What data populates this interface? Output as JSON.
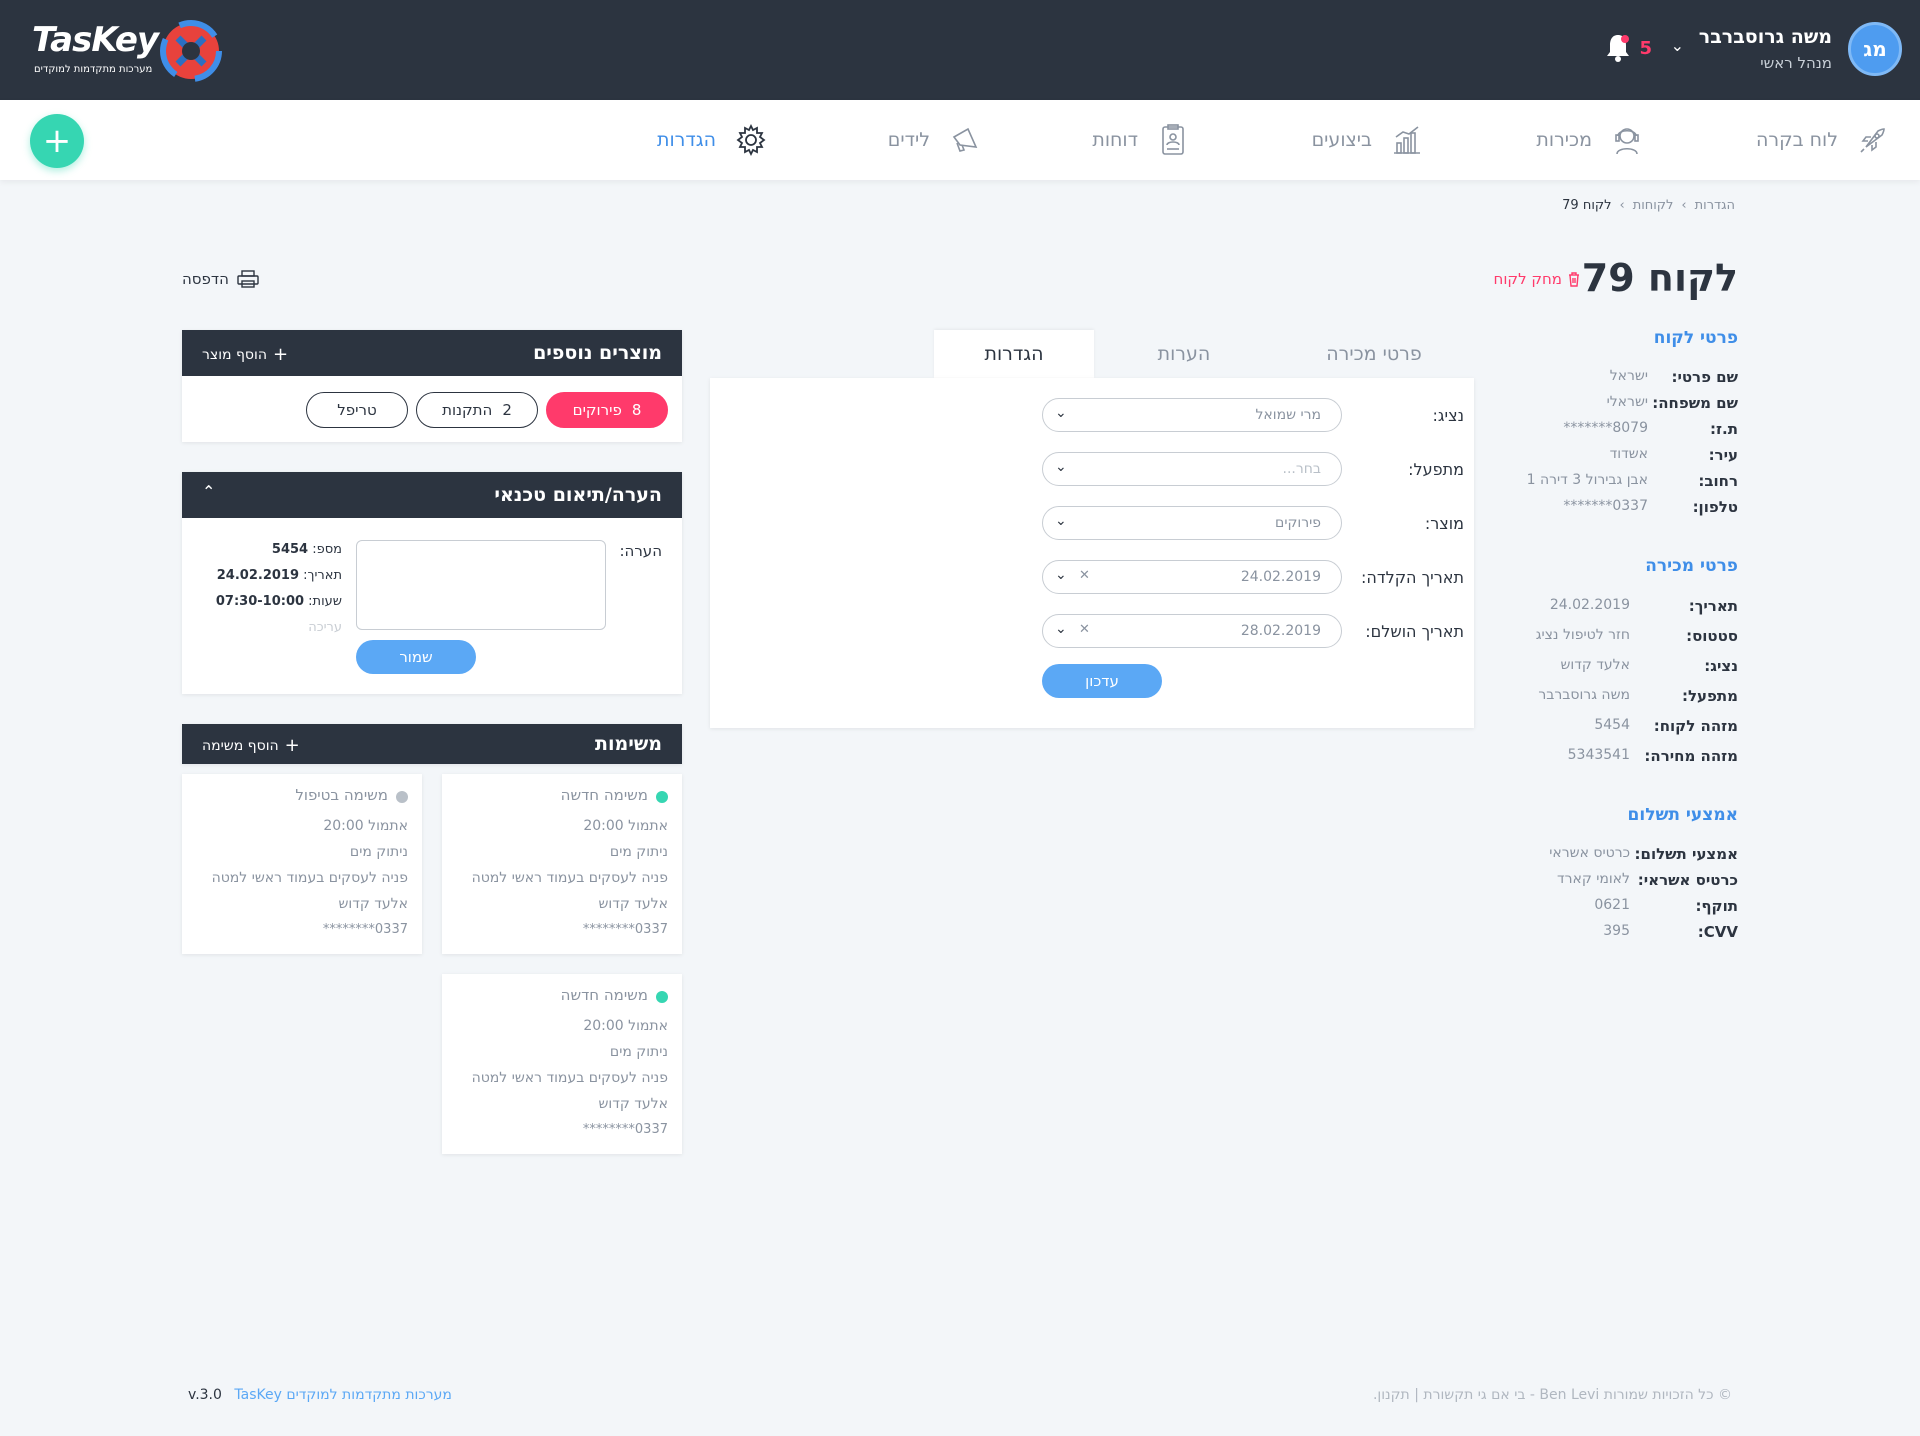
{
  "brand": {
    "name": "TasKey",
    "tagline": "מערכות מתקדמות למוקדים"
  },
  "user": {
    "initials": "מג",
    "name": "משה גרוסברבר",
    "role": "מנהל ראשי",
    "notifications": "5"
  },
  "nav": {
    "items": [
      {
        "label": "לוח בקרה",
        "icon": "rocket-icon"
      },
      {
        "label": "מכירות",
        "icon": "agent-icon"
      },
      {
        "label": "ביצועים",
        "icon": "chart-icon"
      },
      {
        "label": "דוחות",
        "icon": "report-icon"
      },
      {
        "label": "לידים",
        "icon": "megaphone-icon"
      },
      {
        "label": "הגדרות",
        "icon": "gear-icon"
      }
    ],
    "active_color": "#3f8ee8"
  },
  "breadcrumb": {
    "a": "הגדרות",
    "b": "לקוחות",
    "c": "לקוח 79"
  },
  "page": {
    "title": "לקוח 79",
    "delete_label": "מחק לקוח",
    "print_label": "הדפסה"
  },
  "customer": {
    "title": "פרטי לקוח",
    "rows": [
      {
        "label": "שם פרטי:",
        "value": "ישראל"
      },
      {
        "label": "שם משפחה:",
        "value": "ישראלי"
      },
      {
        "label": "ת.ז:",
        "value": "8079*******"
      },
      {
        "label": "עיר:",
        "value": "אשדוד"
      },
      {
        "label": "רחוב:",
        "value": "אבן גבירול 3 דירה 1"
      },
      {
        "label": "טלפון:",
        "value": "0337*******"
      }
    ]
  },
  "sale": {
    "title": "פרטי מכירה",
    "rows": [
      {
        "label": "תאריך:",
        "value": "24.02.2019"
      },
      {
        "label": "סטטוס:",
        "value": "חזר לטיפול נציג"
      },
      {
        "label": "נציג:",
        "value": "אלעד קדוש"
      },
      {
        "label": "מתפעל:",
        "value": "משה גרוסברבר"
      },
      {
        "label": "מזהה לקוח:",
        "value": "5454"
      },
      {
        "label": "מזהה מחירה:",
        "value": "5343541"
      }
    ]
  },
  "payment": {
    "title": "אמצעי תשלום",
    "rows": [
      {
        "label": "אמצעי תשלום:",
        "value": "כרטיס אשראי"
      },
      {
        "label": "כרטיס אשראי:",
        "value": "לאומי קארד"
      },
      {
        "label": "תוקף:",
        "value": "0621"
      },
      {
        "label": "CVV:",
        "value": "395"
      }
    ]
  },
  "tabs": {
    "sale": "פרטי מכירה",
    "notes": "הערות",
    "settings": "הגדרות"
  },
  "form": {
    "rep_label": "נציג:",
    "rep_value": "מרי שמואל",
    "operator_label": "מתפעל:",
    "operator_placeholder": "בחר...",
    "product_label": "מוצר:",
    "product_value": "פירוקים",
    "entry_label": "תאריך הקלדה:",
    "entry_value": "24.02.2019",
    "done_label": "תאריך הושלם:",
    "done_value": "28.02.2019",
    "update_button": "עדכון"
  },
  "products": {
    "title": "מוצרים נוספים",
    "add_label": "הוסף מוצר",
    "chips": [
      {
        "count": "8",
        "label": "פירוקים"
      },
      {
        "count": "2",
        "label": "התקנות"
      },
      {
        "count": "",
        "label": "טריפל"
      }
    ]
  },
  "notes": {
    "title": "הערה/תיאום טכנאי",
    "note_label": "הערה:",
    "number_label": "מספ:",
    "number_value": "5454",
    "date_label": "תאריך:",
    "date_value": "24.02.2019",
    "hours_label": "שעות:",
    "hours_value": "07:30-10:00",
    "edit_label": "עריכה",
    "save_button": "שמור"
  },
  "tasks": {
    "title": "משימות",
    "add_label": "הוסף משימה",
    "cards": [
      {
        "status": "משימה חדשה",
        "status_color": "#36d6b2",
        "time": "אתמול 20:00",
        "type": "ניתוק מים",
        "desc": "פניה לעסקים בעמוד ראשי למטה",
        "agent": "אלעד קדוש",
        "phone": "0337********"
      },
      {
        "status": "משימה בטיפול",
        "status_color": "#b9c0c8",
        "time": "אתמול 20:00",
        "type": "ניתוק מים",
        "desc": "פניה לעסקים בעמוד ראשי למטה",
        "agent": "אלעד קדוש",
        "phone": "0337********"
      },
      {
        "status": "משימה חדשה",
        "status_color": "#36d6b2",
        "time": "אתמול 20:00",
        "type": "ניתוק מים",
        "desc": "פניה לעסקים בעמוד ראשי למטה",
        "agent": "אלעד קדוש",
        "phone": "0337********"
      }
    ]
  },
  "footer": {
    "version": "v.3.0",
    "product": "TasKey מערכות מתקדמות למוקדים",
    "rights": "© כל הזכויות שמורות Ben Levi - בי אם גי תקשורת | תקנון."
  }
}
